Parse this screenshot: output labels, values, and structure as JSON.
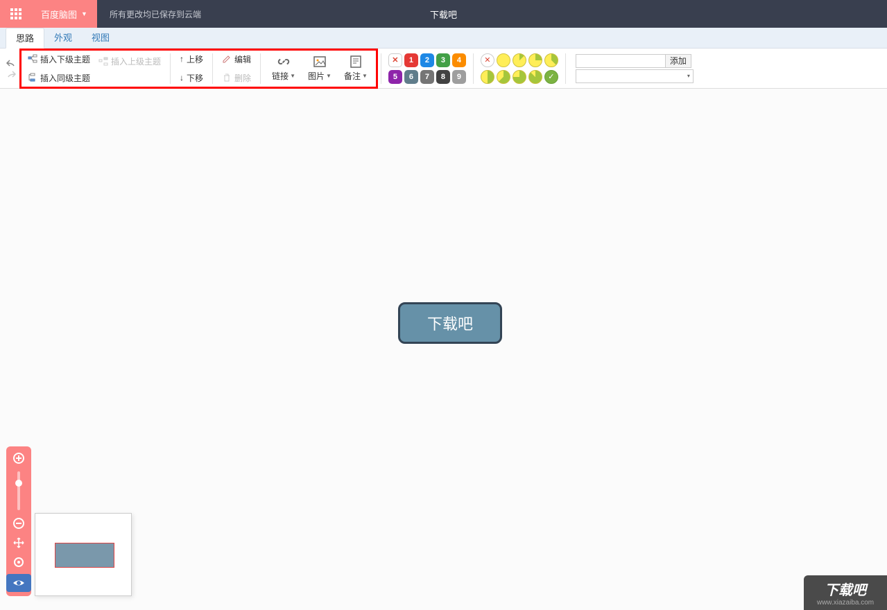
{
  "header": {
    "brand": "百度脑图",
    "save_status": "所有更改均已保存到云端",
    "doc_title": "下载吧"
  },
  "tabs": {
    "mind": "思路",
    "appearance": "外观",
    "view": "视图"
  },
  "toolbar": {
    "insert_child": "插入下级主题",
    "insert_parent": "插入上级主题",
    "insert_sibling": "插入同级主题",
    "move_up": "上移",
    "move_down": "下移",
    "edit": "编辑",
    "delete": "删除",
    "link": "链接",
    "image": "图片",
    "note": "备注",
    "priority_vals": [
      "1",
      "2",
      "3",
      "4",
      "5",
      "6",
      "7",
      "8",
      "9"
    ],
    "tag_add": "添加"
  },
  "canvas": {
    "root_text": "下载吧"
  },
  "watermark": {
    "text": "下载吧",
    "url": "www.xiazaiba.com"
  }
}
